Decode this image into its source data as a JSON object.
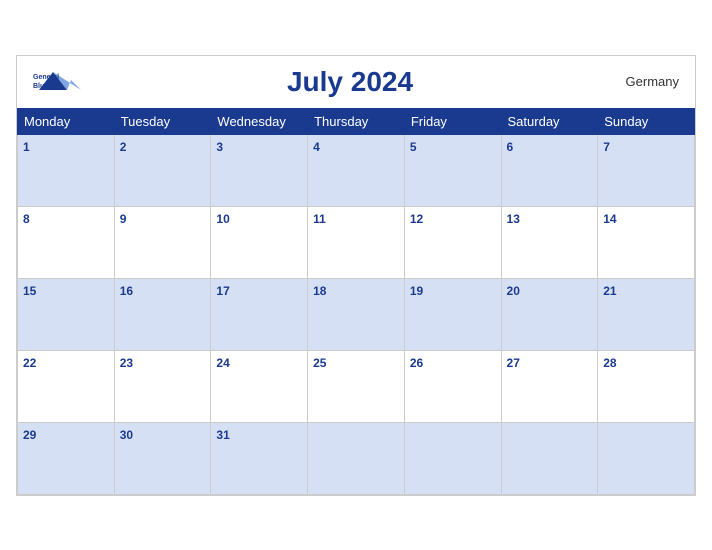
{
  "header": {
    "title": "July 2024",
    "country": "Germany",
    "logo_line1": "General",
    "logo_line2": "Blue"
  },
  "days_of_week": [
    "Monday",
    "Tuesday",
    "Wednesday",
    "Thursday",
    "Friday",
    "Saturday",
    "Sunday"
  ],
  "weeks": [
    [
      1,
      2,
      3,
      4,
      5,
      6,
      7
    ],
    [
      8,
      9,
      10,
      11,
      12,
      13,
      14
    ],
    [
      15,
      16,
      17,
      18,
      19,
      20,
      21
    ],
    [
      22,
      23,
      24,
      25,
      26,
      27,
      28
    ],
    [
      29,
      30,
      31,
      null,
      null,
      null,
      null
    ]
  ]
}
